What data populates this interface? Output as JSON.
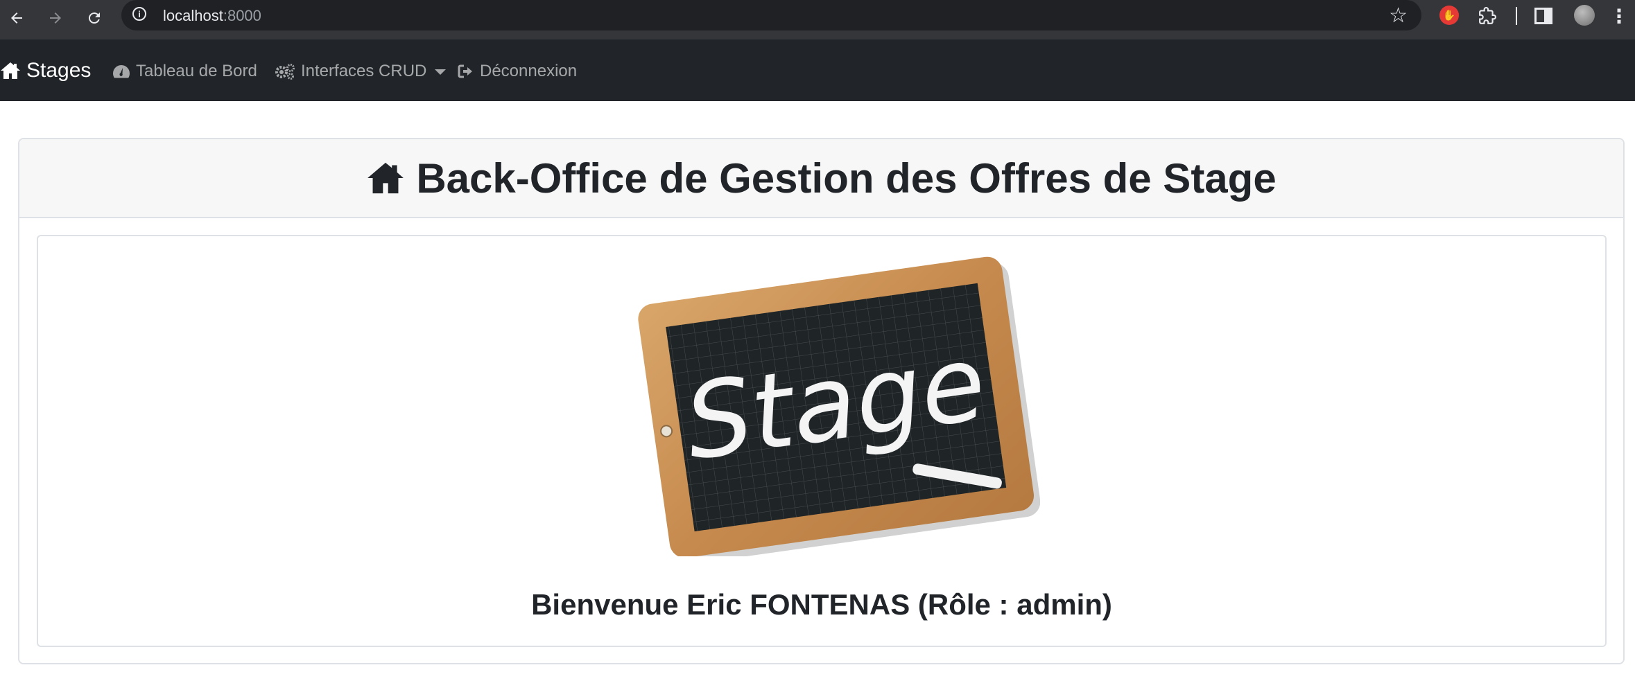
{
  "browser": {
    "url_host": "localhost",
    "url_port": ":8000",
    "icons": {
      "back": "arrow-left-icon",
      "forward": "arrow-right-icon",
      "reload": "reload-icon",
      "site_info": "info-icon",
      "bookmark": "star-icon",
      "extension_stop": "stop-hand-icon",
      "extensions": "puzzle-icon",
      "side_panel": "side-panel-icon",
      "profile": "avatar",
      "menu": "kebab-menu-icon"
    }
  },
  "navbar": {
    "brand": "Stages",
    "links": [
      {
        "label": "Tableau de Bord",
        "icon": "dashboard-icon"
      },
      {
        "label": "Interfaces CRUD",
        "icon": "cogs-icon"
      },
      {
        "label": "Déconnexion",
        "icon": "sign-out-icon"
      }
    ]
  },
  "main": {
    "title": "Back-Office de Gestion des Offres de Stage",
    "image_text": "Stage",
    "welcome": "Bienvenue Eric FONTENAS (Rôle : admin)"
  },
  "colors": {
    "chrome_bg": "#35363a",
    "omnibox_bg": "#202124",
    "navbar_bg": "#212529",
    "card_header_bg": "#f7f7f7",
    "border": "#dee2e6",
    "text": "#212529"
  }
}
